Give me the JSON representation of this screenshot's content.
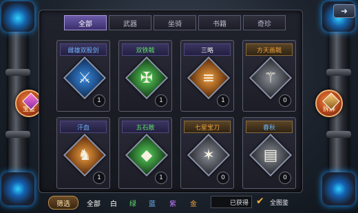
{
  "tabs": [
    {
      "label": "全部",
      "active": true
    },
    {
      "label": "武器",
      "active": false
    },
    {
      "label": "坐骑",
      "active": false
    },
    {
      "label": "书籍",
      "active": false
    },
    {
      "label": "奇珍",
      "active": false
    }
  ],
  "side_buttons": {
    "left_label": "宝鉴",
    "right_label": "拆解"
  },
  "items": [
    {
      "name": "雌雄双股剑",
      "count": "1",
      "name_color": "#6fb6ff",
      "frame": "blue",
      "icon": "crossed-swords-icon"
    },
    {
      "name": "双铁戟",
      "count": "1",
      "name_color": "#5fe06a",
      "frame": "green",
      "icon": "halberd-icon"
    },
    {
      "name": "三略",
      "count": "1",
      "name_color": "#e6e6e6",
      "frame": "orange",
      "icon": "scroll-icon"
    },
    {
      "name": "方天画戟",
      "count": "0",
      "name_color": "#f2a23a",
      "frame": "gray",
      "icon": "trident-icon"
    },
    {
      "name": "汗血",
      "count": "1",
      "name_color": "#6fb6ff",
      "frame": "orange",
      "icon": "warhorse-icon"
    },
    {
      "name": "五石散",
      "count": "1",
      "name_color": "#5fe06a",
      "frame": "green",
      "icon": "powder-icon"
    },
    {
      "name": "七星宝刀",
      "count": "0",
      "name_color": "#f2a23a",
      "frame": "gray",
      "icon": "star-blade-icon"
    },
    {
      "name": "春秋",
      "count": "0",
      "name_color": "#6fb6ff",
      "frame": "gray",
      "icon": "book-icon"
    }
  ],
  "filter": {
    "button_label": "筛选",
    "options": [
      {
        "label": "全部",
        "color": "#ffffff"
      },
      {
        "label": "白",
        "color": "#ffffff"
      },
      {
        "label": "绿",
        "color": "#5fe06a"
      },
      {
        "label": "蓝",
        "color": "#6fb6ff"
      },
      {
        "label": "紫",
        "color": "#c27bff"
      },
      {
        "label": "金",
        "color": "#f2a23a"
      }
    ],
    "obtained_label": "已获得",
    "all_collection_label": "全图鉴"
  },
  "colors": {
    "accent": "#6b5aa8",
    "gold": "#f2a23a"
  }
}
